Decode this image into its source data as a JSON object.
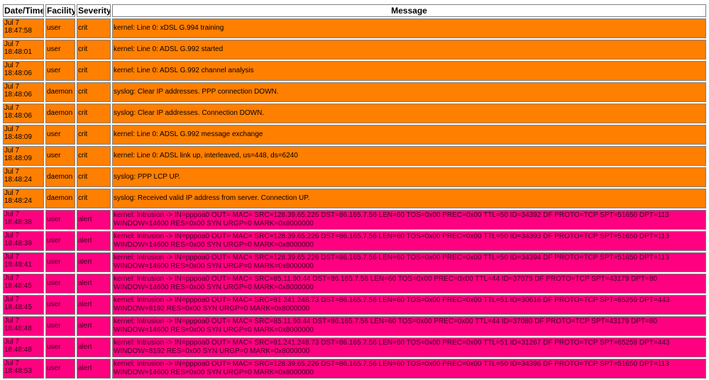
{
  "headers": {
    "datetime": "Date/Time",
    "facility": "Facility",
    "severity": "Severity",
    "message": "Message"
  },
  "colors": {
    "crit_row": "#ff7f00",
    "alert_row": "#ff0080"
  },
  "rows": [
    {
      "level": "crit",
      "date": "Jul 7",
      "time": "18:47:58",
      "facility": "user",
      "severity": "crit",
      "message": "kernel: Line 0: xDSL G.994 training",
      "message2": ""
    },
    {
      "level": "crit",
      "date": "Jul 7",
      "time": "18:48:01",
      "facility": "user",
      "severity": "crit",
      "message": "kernel: Line 0: ADSL G.992 started",
      "message2": ""
    },
    {
      "level": "crit",
      "date": "Jul 7",
      "time": "18:48:06",
      "facility": "user",
      "severity": "crit",
      "message": "kernel: Line 0: ADSL G.992 channel analysis",
      "message2": ""
    },
    {
      "level": "crit",
      "date": "Jul 7",
      "time": "18:48:06",
      "facility": "daemon",
      "severity": "crit",
      "message": "syslog: Clear IP addresses. PPP connection DOWN.",
      "message2": ""
    },
    {
      "level": "crit",
      "date": "Jul 7",
      "time": "18:48:06",
      "facility": "daemon",
      "severity": "crit",
      "message": "syslog: Clear IP addresses. Connection DOWN.",
      "message2": ""
    },
    {
      "level": "crit",
      "date": "Jul 7",
      "time": "18:48:09",
      "facility": "user",
      "severity": "crit",
      "message": "kernel: Line 0: ADSL G.992 message exchange",
      "message2": ""
    },
    {
      "level": "crit",
      "date": "Jul 7",
      "time": "18:48:09",
      "facility": "user",
      "severity": "crit",
      "message": "kernel: Line 0: ADSL link up, interleaved, us=448, ds=6240",
      "message2": ""
    },
    {
      "level": "crit",
      "date": "Jul 7",
      "time": "18:48:24",
      "facility": "daemon",
      "severity": "crit",
      "message": "syslog: PPP LCP UP.",
      "message2": ""
    },
    {
      "level": "crit",
      "date": "Jul 7",
      "time": "18:48:24",
      "facility": "daemon",
      "severity": "crit",
      "message": "syslog: Received valid IP address from server. Connection UP.",
      "message2": ""
    },
    {
      "level": "alert",
      "date": "Jul 7",
      "time": "18:48:38",
      "facility": "user",
      "severity": "alert",
      "message": "kernel: Intrusion -> IN=pppoa0 OUT= MAC= SRC=128.39.65.226 DST=86.165.7.56 LEN=60 TOS=0x00 PREC=0x00 TTL=50 ID=34392 DF PROTO=TCP SPT=51650 DPT=113",
      "message2": "WINDOW=14600 RES=0x00 SYN URGP=0 MARK=0x8000000"
    },
    {
      "level": "alert",
      "date": "Jul 7",
      "time": "18:48:39",
      "facility": "user",
      "severity": "alert",
      "message": "kernel: Intrusion -> IN=pppoa0 OUT= MAC= SRC=128.39.65.226 DST=86.165.7.56 LEN=60 TOS=0x00 PREC=0x00 TTL=50 ID=34393 DF PROTO=TCP SPT=51650 DPT=113",
      "message2": "WINDOW=14600 RES=0x00 SYN URGP=0 MARK=0x8000000"
    },
    {
      "level": "alert",
      "date": "Jul 7",
      "time": "18:48:41",
      "facility": "user",
      "severity": "alert",
      "message": "kernel: Intrusion -> IN=pppoa0 OUT= MAC= SRC=128.39.65.226 DST=86.165.7.56 LEN=60 TOS=0x00 PREC=0x00 TTL=50 ID=34394 DF PROTO=TCP SPT=51650 DPT=113",
      "message2": "WINDOW=14600 RES=0x00 SYN URGP=0 MARK=0x8000000"
    },
    {
      "level": "alert",
      "date": "Jul 7",
      "time": "18:48:45",
      "facility": "user",
      "severity": "alert",
      "message": "kernel: Intrusion -> IN=pppoa0 OUT= MAC= SRC=85.11.90.44 DST=86.165.7.56 LEN=60 TOS=0x00 PREC=0x00 TTL=44 ID=37079 DF PROTO=TCP SPT=43179 DPT=80",
      "message2": "WINDOW=14600 RES=0x00 SYN URGP=0 MARK=0x8000000"
    },
    {
      "level": "alert",
      "date": "Jul 7",
      "time": "18:48:45",
      "facility": "user",
      "severity": "alert",
      "message": "kernel: Intrusion -> IN=pppoa0 OUT= MAC= SRC=91.241.248.73 DST=86.165.7.56 LEN=60 TOS=0x00 PREC=0x00 TTL=51 ID=30616 DF PROTO=TCP SPT=65259 DPT=443",
      "message2": "WINDOW=8192 RES=0x00 SYN URGP=0 MARK=0x8000000"
    },
    {
      "level": "alert",
      "date": "Jul 7",
      "time": "18:48:48",
      "facility": "user",
      "severity": "alert",
      "message": "kernel: Intrusion -> IN=pppoa0 OUT= MAC= SRC=85.11.90.44 DST=86.165.7.56 LEN=60 TOS=0x00 PREC=0x00 TTL=44 ID=37080 DF PROTO=TCP SPT=43179 DPT=80",
      "message2": "WINDOW=14600 RES=0x00 SYN URGP=0 MARK=0x8000000"
    },
    {
      "level": "alert",
      "date": "Jul 7",
      "time": "18:48:48",
      "facility": "user",
      "severity": "alert",
      "message": "kernel: Intrusion -> IN=pppoa0 OUT= MAC= SRC=91.241.248.73 DST=86.165.7.56 LEN=60 TOS=0x00 PREC=0x00 TTL=51 ID=31267 DF PROTO=TCP SPT=65259 DPT=443",
      "message2": "WINDOW=8192 RES=0x00 SYN URGP=0 MARK=0x8000000"
    },
    {
      "level": "alert",
      "date": "Jul 7",
      "time": "18:48:53",
      "facility": "user",
      "severity": "alert",
      "message": "kernel: Intrusion -> IN=pppoa0 OUT= MAC= SRC=128.39.65.226 DST=86.165.7.56 LEN=60 TOS=0x00 PREC=0x00 TTL=50 ID=34396 DF PROTO=TCP SPT=51650 DPT=113",
      "message2": "WINDOW=14600 RES=0x00 SYN URGP=0 MARK=0x8000000"
    }
  ]
}
